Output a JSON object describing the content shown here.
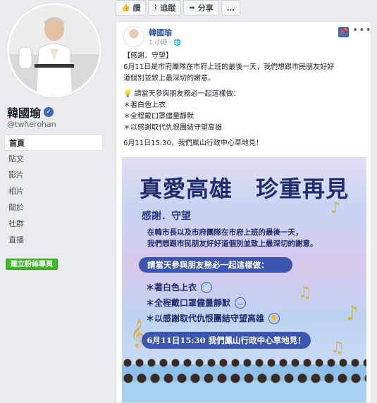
{
  "sidebar": {
    "page_name": "韓國瑜",
    "handle": "@twherohan",
    "nav": [
      "首頁",
      "貼文",
      "影片",
      "相片",
      "關於",
      "社群",
      "直播"
    ],
    "create_button": "建立粉絲專頁"
  },
  "topbar": {
    "like": "讚",
    "follow": "追蹤",
    "share": "分享",
    "more": "…"
  },
  "post": {
    "author": "韓國瑜",
    "time": "1 小時 · ",
    "lines": [
      "【感謝．守望】",
      "6月11日是市府團隊在市府上班的最後一天，我們想跟市民朋友好好",
      "道個別並致上最深切的謝意。",
      "",
      "💡 請當天參與朋友務必一起這樣做：",
      "＊著白色上衣",
      "＊全程戴口罩儘量靜默",
      "＊以感謝取代仇恨團結守望高雄",
      "",
      "6月11日15:30，我們鳳山行政中心草地見！"
    ]
  },
  "poster": {
    "title": "真愛高雄　珍重再見",
    "subtitle": "感謝．守望",
    "body_1": "在韓市長以及市府團隊在市府上班的最後一天，",
    "body_2": "我們想跟市民朋友好好道個別並致上最深切的謝意。",
    "pill_1": "請當天參與朋友務必一起這樣做：",
    "items": [
      "＊著白色上衣",
      "＊全程戴口罩儘量靜默",
      "＊以感謝取代仇恨團結守望高雄"
    ],
    "pill_2": "6月11日15:30 我們鳳山行政中心草地見！"
  },
  "colors": {
    "brand_blue": "#4267b2",
    "link_blue": "#365899",
    "create_green": "#42b72a",
    "poster_navy": "#1f2d6e"
  }
}
